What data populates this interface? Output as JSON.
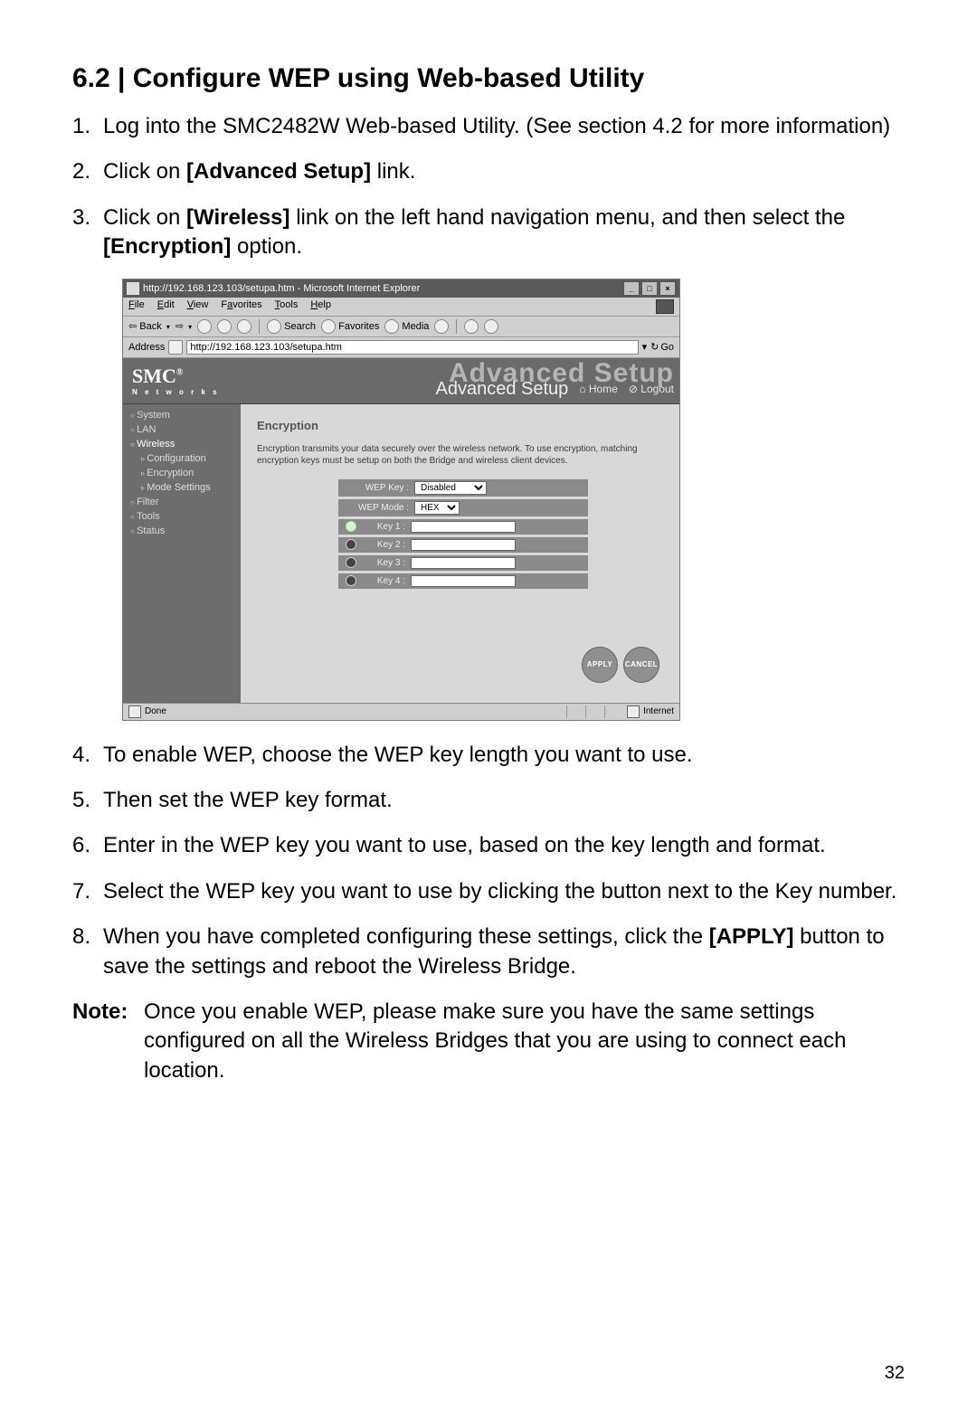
{
  "heading": "6.2 | Configure WEP using Web-based Utility",
  "steps_top": [
    {
      "n": "1.",
      "pre": "Log into the SMC2482W Web-based Utility. (See section 4.2 for more information)"
    },
    {
      "n": "2.",
      "pre": "Click on ",
      "b": "[Advanced Setup]",
      "post": " link."
    },
    {
      "n": "3.",
      "pre": "Click on ",
      "b": "[Wireless]",
      "post": " link on the left hand navigation menu, and then select the ",
      "b2": "[Encryption]",
      "post2": " option."
    }
  ],
  "browser": {
    "title": "http://192.168.123.103/setupa.htm - Microsoft Internet Explorer",
    "menus": [
      "File",
      "Edit",
      "View",
      "Favorites",
      "Tools",
      "Help"
    ],
    "tb_back": "Back",
    "tb_search": "Search",
    "tb_fav": "Favorites",
    "tb_media": "Media",
    "addr_label": "Address",
    "addr_value": "http://192.168.123.103/setupa.htm",
    "go": "Go",
    "status_left": "Done",
    "status_right": "Internet"
  },
  "brand": {
    "name": "SMC",
    "sub": "N e t w o r k s",
    "reg": "®"
  },
  "watermark": "Advanced Setup",
  "subbanner": {
    "title": "Advanced Setup",
    "home": "Home",
    "logout": "Logout"
  },
  "sidebar": {
    "system": "System",
    "lan": "LAN",
    "wireless": "Wireless",
    "configuration": "Configuration",
    "encryption": "Encryption",
    "mode": "Mode Settings",
    "filter": "Filter",
    "tools": "Tools",
    "status": "Status"
  },
  "panel": {
    "title": "Encryption",
    "desc": "Encryption transmits your data securely over the wireless network. To use encryption, matching encryption keys must be setup on both the Bridge and wireless client devices.",
    "wepkey_label": "WEP Key :",
    "wepkey_value": "Disabled",
    "wepmode_label": "WEP Mode :",
    "wepmode_value": "HEX",
    "key1": "Key 1 :",
    "key2": "Key 2 :",
    "key3": "Key 3 :",
    "key4": "Key 4 :",
    "apply": "APPLY",
    "cancel": "CANCEL"
  },
  "steps_bottom": [
    {
      "n": "4.",
      "t": "To enable WEP, choose the WEP key length you want to use."
    },
    {
      "n": "5.",
      "t": "Then set the WEP key format."
    },
    {
      "n": "6.",
      "t": "Enter in the WEP key you want to use, based on the key length and format."
    },
    {
      "n": "7.",
      "t": "Select the WEP key you want to use by clicking the button next to the Key number."
    },
    {
      "n": "8.",
      "pre": "When you have completed configuring these settings, click the ",
      "b": "[APPLY]",
      "post": " button to save the settings and reboot the Wireless Bridge."
    }
  ],
  "note": {
    "label": "Note:",
    "text": "Once you enable WEP, please make sure you have the same settings configured on all the Wireless Bridges that you are using to connect each location."
  },
  "page_number": "32"
}
